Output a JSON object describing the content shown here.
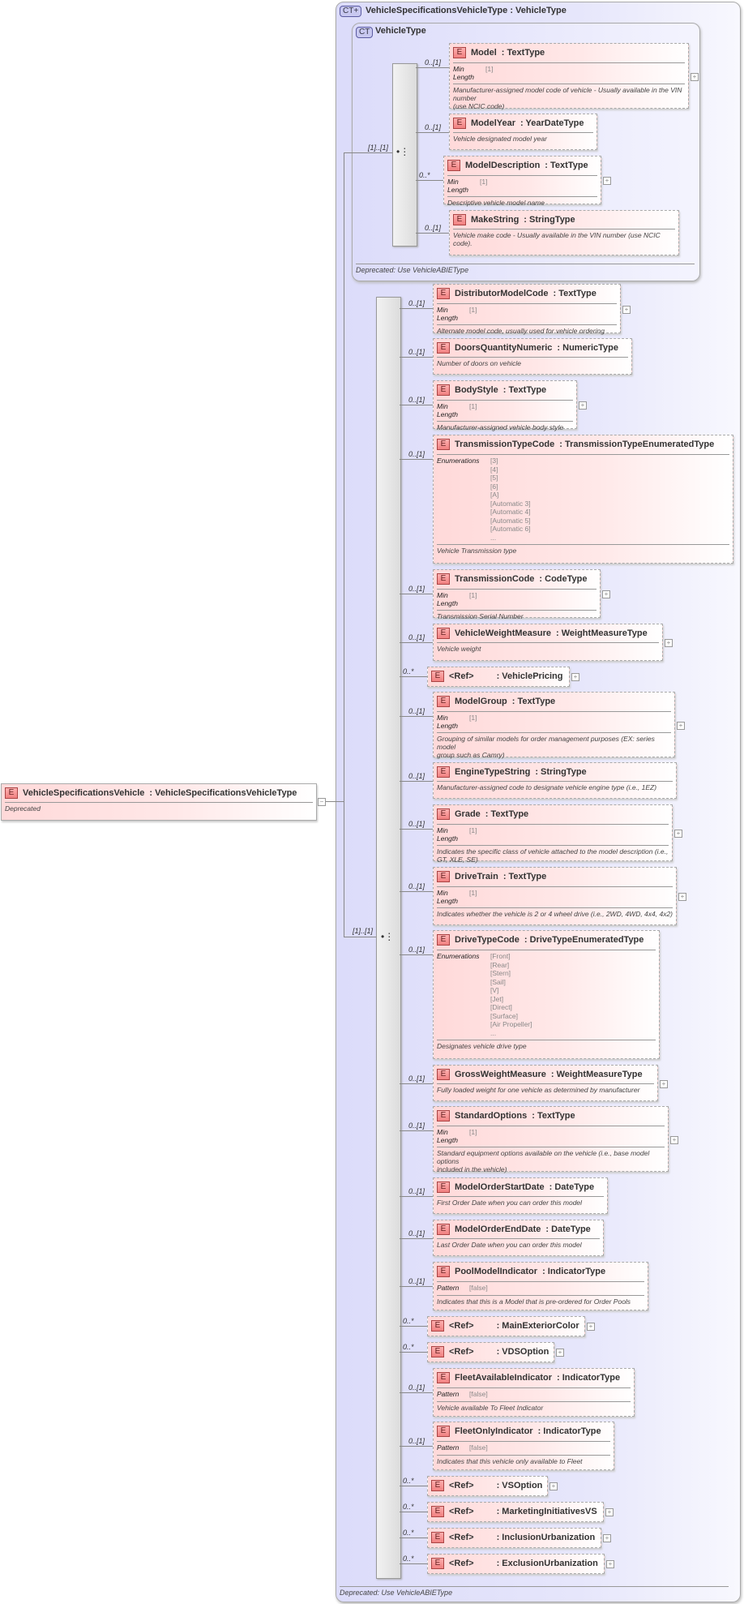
{
  "element_badge": "E",
  "root": {
    "name": "VehicleSpecificationsVehicle",
    "type": ": VehicleSpecificationsVehicleType",
    "note": "Deprecated"
  },
  "outer": {
    "badge": "CT+",
    "name": "VehicleSpecificationsVehicleType",
    "base": ": VehicleType",
    "note": "Deprecated: Use VehicleABIEType",
    "cardinality": "[1]..[1]"
  },
  "inner": {
    "badge": "CT",
    "name": "VehicleType",
    "note": "Deprecated: Use VehicleABIEType",
    "cardinality": "[1]..[1]"
  },
  "inner_children": [
    {
      "name": "Model",
      "type": ": TextType",
      "card": "0..[1]",
      "facet": {
        "label": "Min Length",
        "values": [
          "[1]"
        ]
      },
      "desc": "Manufacturer-assigned model code of vehicle - Usually available in the VIN number\n(use NCIC code)",
      "expand": true
    },
    {
      "name": "ModelYear",
      "type": ": YearDateType",
      "card": "0..[1]",
      "desc": "Vehicle designated model year"
    },
    {
      "name": "ModelDescription",
      "type": ": TextType",
      "card": "0..*",
      "facet": {
        "label": "Min Length",
        "values": [
          "[1]"
        ]
      },
      "desc": "Descriptive vehicle model name",
      "expand": true
    },
    {
      "name": "MakeString",
      "type": ": StringType",
      "card": "0..[1]",
      "desc": "Vehicle make code - Usually available in the VIN number (use NCIC code)."
    }
  ],
  "outer_children": [
    {
      "name": "DistributorModelCode",
      "type": ": TextType",
      "card": "0..[1]",
      "facet": {
        "label": "Min Length",
        "values": [
          "[1]"
        ]
      },
      "desc": "Alternate model code, usually used for vehicle ordering",
      "expand": true
    },
    {
      "name": "DoorsQuantityNumeric",
      "type": ": NumericType",
      "card": "0..[1]",
      "desc": "Number of doors on vehicle"
    },
    {
      "name": "BodyStyle",
      "type": ": TextType",
      "card": "0..[1]",
      "facet": {
        "label": "Min Length",
        "values": [
          "[1]"
        ]
      },
      "desc": "Manufacturer-assigned vehicle body style",
      "expand": true
    },
    {
      "name": "TransmissionTypeCode",
      "type": ": TransmissionTypeEnumeratedType",
      "card": "0..[1]",
      "facet": {
        "label": "Enumerations",
        "enum": true,
        "values": [
          "[3]",
          "[4]",
          "[5]",
          "[6]",
          "[A]",
          "[Automatic 3]",
          "[Automatic 4]",
          "[Automatic 5]",
          "[Automatic 6]",
          "..."
        ]
      },
      "desc": "Vehicle Transmission type"
    },
    {
      "name": "TransmissionCode",
      "type": ": CodeType",
      "card": "0..[1]",
      "facet": {
        "label": "Min Length",
        "values": [
          "[1]"
        ]
      },
      "desc": "Transmission Serial Number",
      "expand": true
    },
    {
      "name": "VehicleWeightMeasure",
      "type": ": WeightMeasureType",
      "card": "0..[1]",
      "desc": "Vehicle weight",
      "expand": true
    },
    {
      "ref": "<Ref>",
      "type": ": VehiclePricing",
      "card": "0..*",
      "expand": true
    },
    {
      "name": "ModelGroup",
      "type": ": TextType",
      "card": "0..[1]",
      "facet": {
        "label": "Min Length",
        "values": [
          "[1]"
        ]
      },
      "desc": "Grouping of similar models for order management purposes (EX: series model\ngroup such as Camry)",
      "expand": true
    },
    {
      "name": "EngineTypeString",
      "type": ": StringType",
      "card": "0..[1]",
      "desc": "Manufacturer-assigned code to designate vehicle engine type (i.e., 1EZ)"
    },
    {
      "name": "Grade",
      "type": ": TextType",
      "card": "0..[1]",
      "facet": {
        "label": "Min Length",
        "values": [
          "[1]"
        ]
      },
      "desc": "Indicates the specific class of vehicle attached to the model description (i.e., GT, XLE, SE)",
      "expand": true
    },
    {
      "name": "DriveTrain",
      "type": ": TextType",
      "card": "0..[1]",
      "facet": {
        "label": "Min Length",
        "values": [
          "[1]"
        ]
      },
      "desc": "Indicates whether the vehicle is 2 or 4 wheel drive (i.e., 2WD, 4WD, 4x4, 4x2)",
      "expand": true
    },
    {
      "name": "DriveTypeCode",
      "type": ": DriveTypeEnumeratedType",
      "card": "0..[1]",
      "facet": {
        "label": "Enumerations",
        "enum": true,
        "values": [
          "[Front]",
          "[Rear]",
          "[Stern]",
          "[Sail]",
          "[V]",
          "[Jet]",
          "[Direct]",
          "[Surface]",
          "[Air Propeller]",
          "..."
        ]
      },
      "desc": "Designates vehicle drive type"
    },
    {
      "name": "GrossWeightMeasure",
      "type": ": WeightMeasureType",
      "card": "0..[1]",
      "desc": "Fully loaded weight for one vehicle as determined by manufacturer",
      "expand": true
    },
    {
      "name": "StandardOptions",
      "type": ": TextType",
      "card": "0..[1]",
      "facet": {
        "label": "Min Length",
        "values": [
          "[1]"
        ]
      },
      "desc": "Standard equipment options available on the vehicle (i.e., base model options\nincluded in the vehicle)",
      "expand": true
    },
    {
      "name": "ModelOrderStartDate",
      "type": ": DateType",
      "card": "0..[1]",
      "desc": "First Order Date when you can order this model"
    },
    {
      "name": "ModelOrderEndDate",
      "type": ": DateType",
      "card": "0..[1]",
      "desc": "Last Order Date when you can order this model"
    },
    {
      "name": "PoolModelIndicator",
      "type": ": IndicatorType",
      "card": "0..[1]",
      "facet": {
        "label": "Pattern",
        "values": [
          "[false]"
        ]
      },
      "desc": "Indicates that this is a Model that is pre-ordered for Order Pools"
    },
    {
      "ref": "<Ref>",
      "type": ": MainExteriorColor",
      "card": "0..*",
      "expand": true
    },
    {
      "ref": "<Ref>",
      "type": ": VDSOption",
      "card": "0..*",
      "expand": true
    },
    {
      "name": "FleetAvailableIndicator",
      "type": ": IndicatorType",
      "card": "0..[1]",
      "facet": {
        "label": "Pattern",
        "values": [
          "[false]"
        ]
      },
      "desc": "Vehicle available To Fleet Indicator"
    },
    {
      "name": "FleetOnlyIndicator",
      "type": ": IndicatorType",
      "card": "0..[1]",
      "facet": {
        "label": "Pattern",
        "values": [
          "[false]"
        ]
      },
      "desc": "Indicates that this vehicle only available to Fleet"
    },
    {
      "ref": "<Ref>",
      "type": ": VSOption",
      "card": "0..*",
      "expand": true
    },
    {
      "ref": "<Ref>",
      "type": ": MarketingInitiativesVS",
      "card": "0..*",
      "expand": true
    },
    {
      "ref": "<Ref>",
      "type": ": InclusionUrbanization",
      "card": "0..*",
      "expand": true
    },
    {
      "ref": "<Ref>",
      "type": ": ExclusionUrbanization",
      "card": "0..*",
      "expand": true
    }
  ]
}
